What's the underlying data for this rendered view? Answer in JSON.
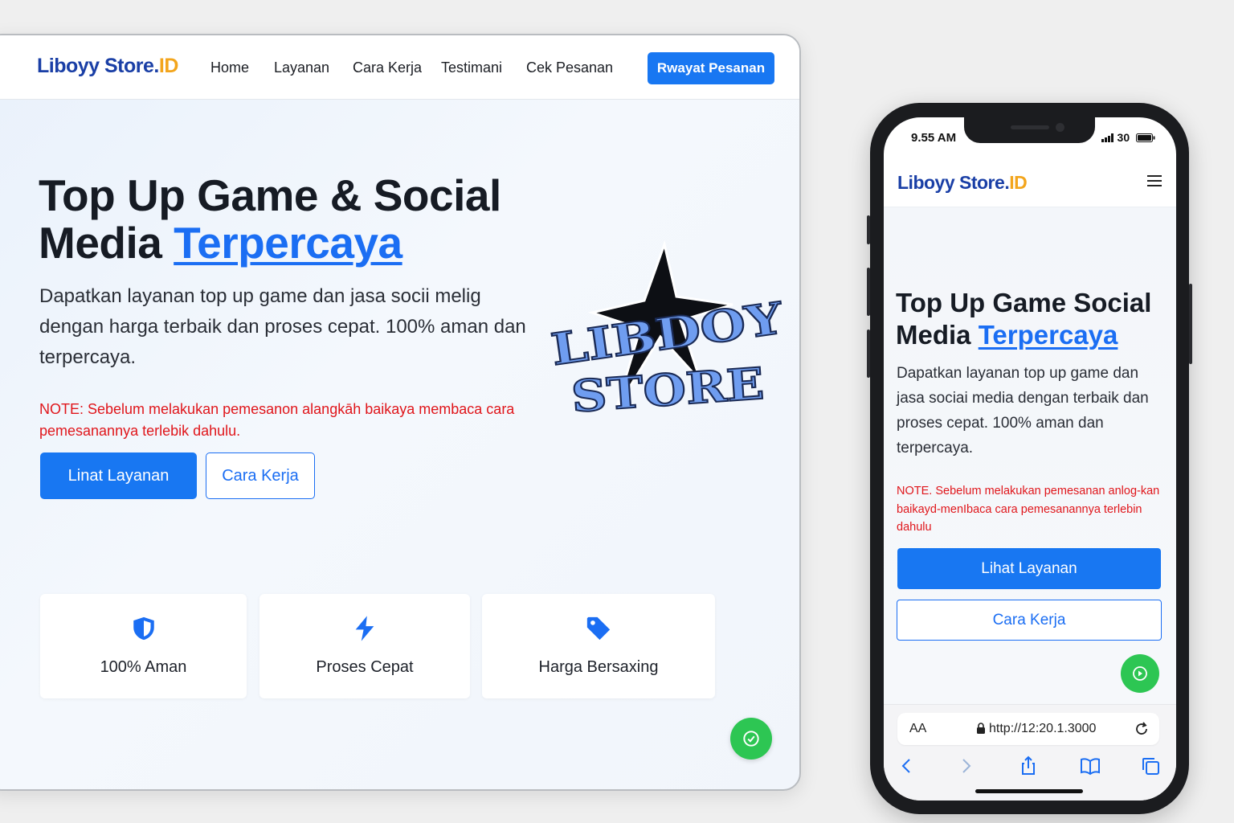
{
  "desktop": {
    "logo": {
      "main": "Liboyy Store",
      "dot": ".",
      "id": "ID"
    },
    "nav": [
      "Home",
      "Layanan",
      "Cara Kerja",
      "Testimani",
      "Cek Pesanan"
    ],
    "cta": "Rwayat Pesanan",
    "hero": {
      "title_line1": "Top Up Game & Social",
      "title_line2": "Media ",
      "title_accent": "Terpercaya",
      "subtitle": "Dapatkan layanan top up game dan jasa socii melig dengan harga terbaik dan proses cepat. 100% aman dan terpercaya.",
      "note": "NOTE: Sebelum melakukan pemesanon alangkāh baikaya membaca cara pemesanannya terlebik dahulu.",
      "primary_button": "Linat Layanan",
      "secondary_button": "Cara Kerja"
    },
    "features": [
      {
        "icon": "shield-icon",
        "label": "100% Aman"
      },
      {
        "icon": "lightning-icon",
        "label": "Proses Cepat"
      },
      {
        "icon": "price-tag-icon",
        "label": "Harga Bersaxing"
      }
    ],
    "art_logo": {
      "line1": "LIBDOY",
      "line2": "STORE"
    }
  },
  "phone": {
    "status_time": "9.55 AM",
    "status_signal": "30",
    "logo": {
      "main": "Liboyy Store",
      "dot": ".",
      "id": "ID"
    },
    "hero": {
      "title_line1": "Top Up Game Social",
      "title_line2": "Media ",
      "title_accent": "Terpercaya",
      "subtitle": "Dapatkan layanan top up game dan jasa sociai media dengan terbaik dan proses cepat. 100% aman dan terpercaya.",
      "note": "NOTE. Sebelum melakukan pemesanan anlog-kan baikayd-menIbaca cara pemesanannya terlebin dahulu",
      "primary_button": "Lihat Layanan",
      "secondary_button": "Cara Kerja"
    },
    "browser": {
      "aa": "AA",
      "url": "http://12:20.1.3000"
    }
  },
  "colors": {
    "brand_blue": "#1877f2",
    "logo_navy": "#1a3fa6",
    "logo_orange": "#f3a51c",
    "note_red": "#e0161b",
    "whatsapp_green": "#2dc653"
  }
}
